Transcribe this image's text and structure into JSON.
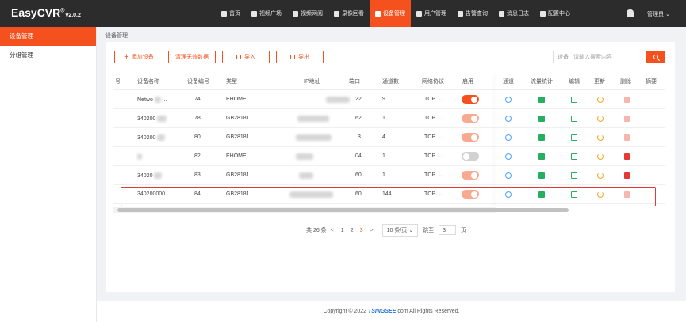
{
  "app": {
    "name": "EasyCVR",
    "reg": "®",
    "version": "v2.0.2"
  },
  "nav": [
    {
      "label": "首页",
      "active": false
    },
    {
      "label": "视频广场",
      "active": false
    },
    {
      "label": "视频网阅",
      "active": false
    },
    {
      "label": "录像回看",
      "active": false
    },
    {
      "label": "设备管理",
      "active": true
    },
    {
      "label": "用户管理",
      "active": false
    },
    {
      "label": "告警查询",
      "active": false
    },
    {
      "label": "消息日志",
      "active": false
    },
    {
      "label": "配置中心",
      "active": false
    }
  ],
  "user": {
    "label": "管理员",
    "caret": "⌄"
  },
  "sidebar": [
    {
      "label": "设备管理",
      "active": true
    },
    {
      "label": "分组管理",
      "active": false
    }
  ],
  "breadcrumb": "设备管理",
  "toolbar": {
    "add": "添加设备",
    "clean": "清理无效数据",
    "import": "导入",
    "export": "导出",
    "search_type": "设备",
    "search_placeholder": "请输入搜索内容"
  },
  "table": {
    "headers": [
      "号",
      "设备名称",
      "设备编号",
      "类型",
      "IP地址",
      "端口",
      "通道数",
      "网络协议",
      "启用",
      "通道",
      "流量统计",
      "编辑",
      "更新",
      "删除",
      "摘要"
    ],
    "rows": [
      {
        "name": "Netwo",
        "name_tail": "...",
        "num": "74",
        "type": "EHOME",
        "port": "22",
        "channels": "9",
        "protocol": "TCP",
        "enabled": "on",
        "summary": "..."
      },
      {
        "name": "340200",
        "name_tail": "",
        "num": "78",
        "type": "GB28181",
        "port": "62",
        "channels": "1",
        "protocol": "TCP",
        "enabled": "on",
        "summary": "..."
      },
      {
        "name": "340200",
        "name_tail": "",
        "num": "80",
        "type": "GB28181",
        "port": "3",
        "channels": "4",
        "protocol": "TCP",
        "enabled": "on",
        "summary": "..."
      },
      {
        "name": "",
        "name_tail": "",
        "num": "82",
        "type": "EHOME",
        "port": "04",
        "channels": "1",
        "protocol": "TCP",
        "enabled": "off",
        "summary": "..."
      },
      {
        "name": "34020",
        "name_tail": "",
        "num": "83",
        "type": "GB28181",
        "port": "60",
        "channels": "1",
        "protocol": "TCP",
        "enabled": "on",
        "summary": "..."
      },
      {
        "name": "340200000...",
        "name_tail": "",
        "num": "84",
        "type": "GB28181",
        "port": "60",
        "channels": "144",
        "protocol": "TCP",
        "enabled": "on",
        "summary": "..."
      }
    ]
  },
  "pager": {
    "total": "共 26 条",
    "prev": "<",
    "pages": [
      "1",
      "2",
      "3"
    ],
    "active_page": "3",
    "next": ">",
    "size": "10 条/页",
    "size_caret": "⌄",
    "jump_label": "跳至",
    "jump_value": "3",
    "jump_unit": "页"
  },
  "footer": {
    "prefix": "Copyright © 2022",
    "brand": "TSINGSEE",
    "suffix": ".com All Rights Reserved."
  },
  "colors": {
    "accent": "#f4511e",
    "topbar": "#2c2c2c",
    "highlight": "#e53935"
  }
}
